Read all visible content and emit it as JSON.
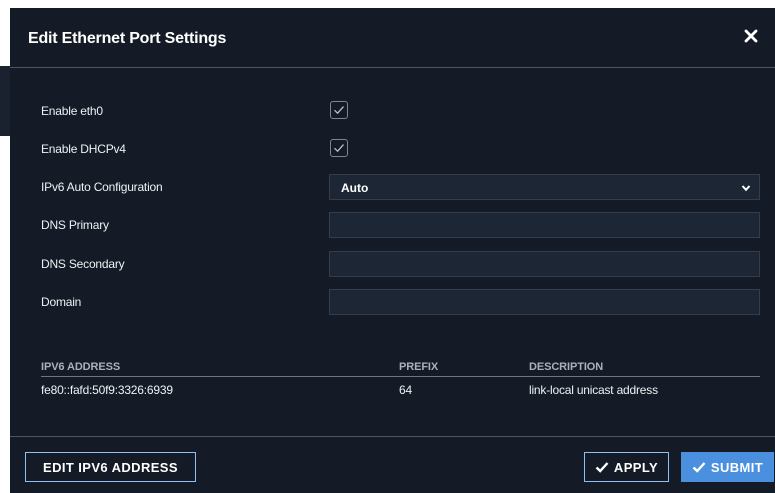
{
  "dialog": {
    "title": "Edit Ethernet Port Settings",
    "close_icon": "close-icon"
  },
  "form": {
    "enable_eth0": {
      "label": "Enable eth0",
      "checked": true
    },
    "enable_dhcpv4": {
      "label": "Enable DHCPv4",
      "checked": true
    },
    "ipv6_auto_config": {
      "label": "IPv6 Auto Configuration",
      "value": "Auto",
      "icon": "chevron-down-icon"
    },
    "dns_primary": {
      "label": "DNS Primary",
      "value": ""
    },
    "dns_secondary": {
      "label": "DNS Secondary",
      "value": ""
    },
    "domain": {
      "label": "Domain",
      "value": ""
    }
  },
  "ipv6_table": {
    "columns": [
      "IPV6 ADDRESS",
      "PREFIX",
      "DESCRIPTION"
    ],
    "rows": [
      [
        "fe80::fafd:50f9:3326:6939",
        "64",
        "link-local unicast address"
      ]
    ]
  },
  "footer": {
    "edit_label": "EDIT IPV6 ADDRESS",
    "apply_label": "APPLY",
    "submit_label": "SUBMIT",
    "check_icon": "check-icon"
  },
  "colors": {
    "dialog_bg": "#141b26",
    "input_bg": "#1d2634",
    "accent": "#4a90df",
    "outline": "#8ec1f1"
  }
}
